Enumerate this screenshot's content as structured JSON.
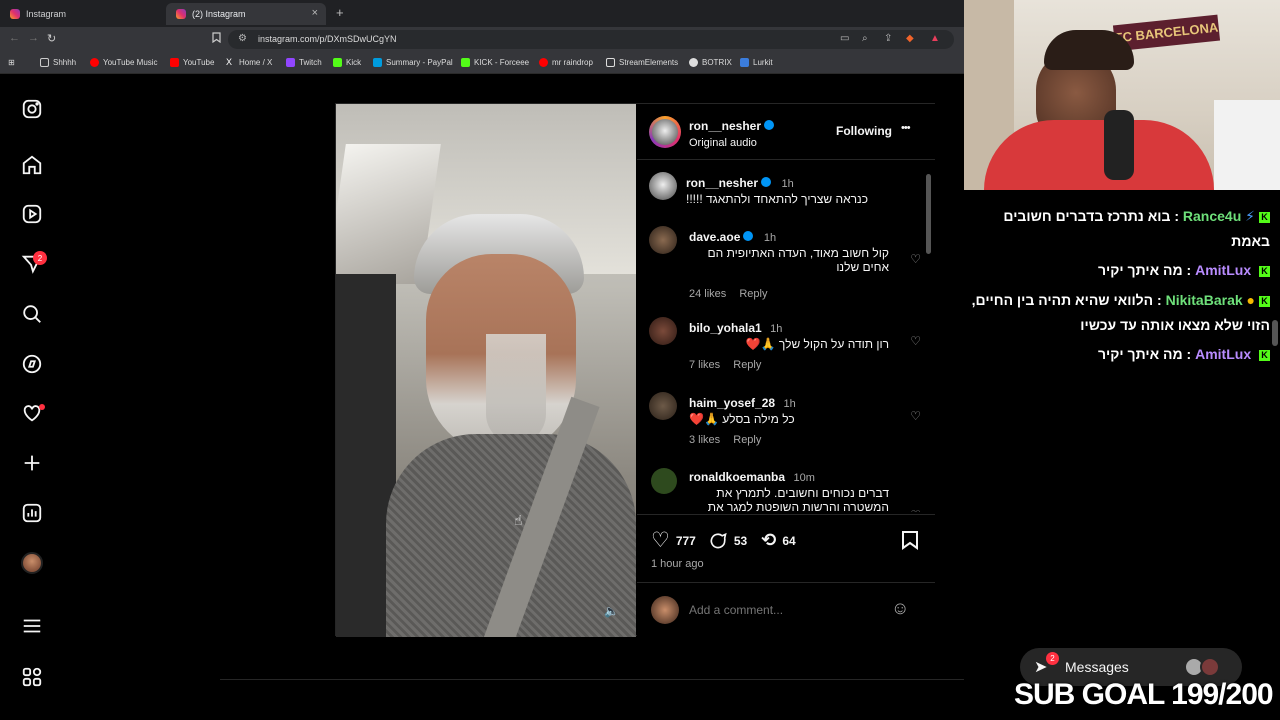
{
  "browser": {
    "tabs": [
      {
        "label": "Instagram"
      },
      {
        "label": "(2) Instagram"
      }
    ],
    "new_tab": "+",
    "close_tab": "×",
    "url": "instagram.com/p/DXmSDwUCgYN",
    "bookmarks": [
      "Shhhh",
      "YouTube Music",
      "YouTube",
      "Home / X",
      "Twitch",
      "Kick",
      "Summary - PayPal",
      "KICK - Forceee",
      "mr raindrop",
      "StreamElements",
      "BOTRIX",
      "Lurkit"
    ]
  },
  "sidebar": {
    "notifications_count": "2"
  },
  "post": {
    "author": "ron__nesher",
    "audio": "Original audio",
    "follow_label": "Following",
    "more": "•••",
    "caption": {
      "user": "ron__nesher",
      "time": "1h",
      "text": "כנראה שצריך להתאחד ולהתאגד !!!!!"
    },
    "comments": [
      {
        "user": "dave.aoe",
        "time": "1h",
        "text": "קול חשוב מאוד, העדה האתיופית הם אחים שלנו",
        "likes": "24 likes",
        "reply": "Reply"
      },
      {
        "user": "bilo_yohala1",
        "time": "1h",
        "text": "רון תודה על הקול שלך 🙏❤️",
        "likes": "7 likes",
        "reply": "Reply"
      },
      {
        "user": "haim_yosef_28",
        "time": "1h",
        "text": "כל מילה בסלע 🙏❤️",
        "likes": "3 likes",
        "reply": "Reply"
      },
      {
        "user": "ronaldkoemanba",
        "time": "10m",
        "text": "דברים נכוחים וחשובים. לתמרץ את המשטרה והרשות השופטת למגר את",
        "likes": "",
        "reply": ""
      }
    ],
    "likes_count": "777",
    "comments_count": "53",
    "reposts_count": "64",
    "posted": "1 hour ago",
    "add_comment_placeholder": "Add a comment..."
  },
  "stream": {
    "chat": [
      {
        "user": "Rance4u",
        "text": "בוא נתרכז בדברים חשובים באמת"
      },
      {
        "user": "AmitLux",
        "text": "מה איתך יקיר"
      },
      {
        "user": "NikitaBarak",
        "text": "הלוואי שהיא תהיה בין החיים, הזוי שלא מצאו אותה עד עכשיו"
      },
      {
        "user": "AmitLux",
        "text": "מה איתך יקיר"
      }
    ],
    "messages_label": "Messages",
    "messages_badge": "2",
    "sub_goal": "SUB GOAL 199/200",
    "banner_text": "FC BARCELONA"
  },
  "colors": {
    "instagram_blue": "#0095f6",
    "kick_green": "#53fc18",
    "badge_red": "#ff3040"
  }
}
